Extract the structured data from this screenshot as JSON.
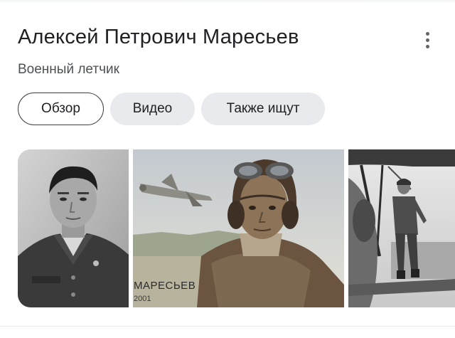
{
  "header": {
    "title": "Алексей Петрович Маресьев",
    "subtitle": "Военный летчик",
    "more_icon": "more-vert-icon"
  },
  "chips": [
    {
      "label": "Обзор",
      "active": true
    },
    {
      "label": "Видео",
      "active": false
    },
    {
      "label": "Также ищут",
      "active": false
    }
  ],
  "gallery": {
    "stamp_caption": "МАРЕСЬЕВ",
    "stamp_year": "2001"
  },
  "colors": {
    "text": "#202124",
    "chip_bg": "#e8eaed",
    "chip_border": "#3c4043",
    "subtext": "#4d5156"
  }
}
